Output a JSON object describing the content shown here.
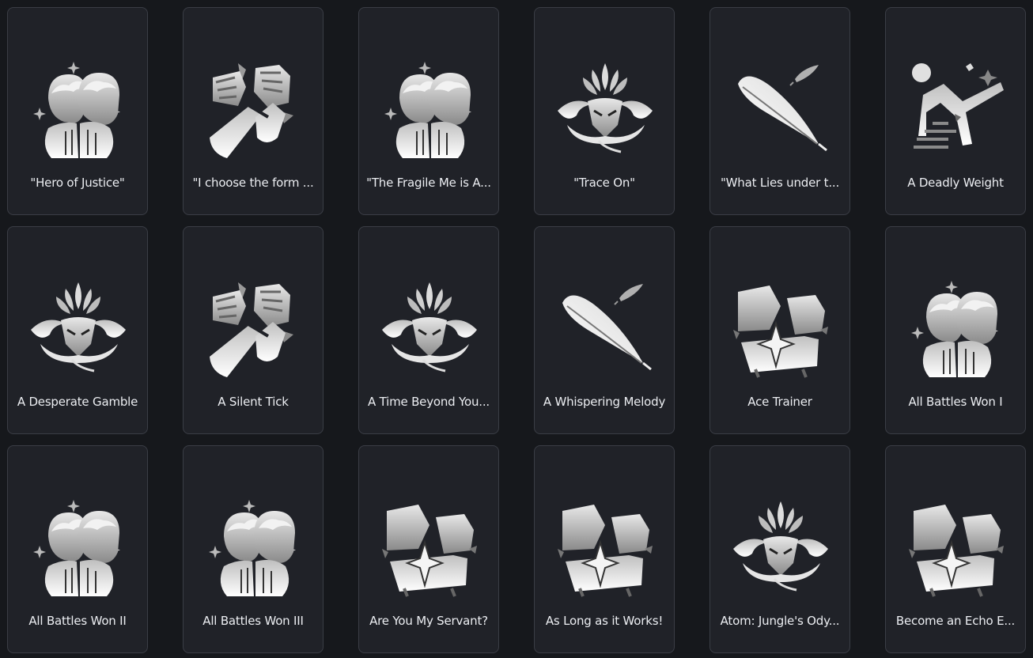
{
  "achievements": [
    {
      "name": "\"Hero of Justice\"",
      "icon": "twins-portrait-icon"
    },
    {
      "name": "\"I choose the form ...",
      "icon": "clashing-fists-icon"
    },
    {
      "name": "\"The Fragile Me is A...",
      "icon": "twins-portrait-icon"
    },
    {
      "name": "\"Trace On\"",
      "icon": "dragon-emblem-icon"
    },
    {
      "name": "\"What Lies under t...",
      "icon": "feather-icon"
    },
    {
      "name": "A Deadly Weight",
      "icon": "falling-figure-icon"
    },
    {
      "name": "A Desperate Gamble",
      "icon": "dragon-emblem-icon"
    },
    {
      "name": "A Silent Tick",
      "icon": "clashing-fists-icon"
    },
    {
      "name": "A Time Beyond You...",
      "icon": "dragon-emblem-icon"
    },
    {
      "name": "A Whispering Melody",
      "icon": "feather-icon"
    },
    {
      "name": "Ace Trainer",
      "icon": "shattered-cube-icon"
    },
    {
      "name": "All Battles Won I",
      "icon": "twins-portrait-icon"
    },
    {
      "name": "All Battles Won II",
      "icon": "twins-portrait-icon"
    },
    {
      "name": "All Battles Won III",
      "icon": "twins-portrait-icon"
    },
    {
      "name": "Are You My Servant?",
      "icon": "shattered-cube-icon"
    },
    {
      "name": "As Long as it Works!",
      "icon": "shattered-cube-icon"
    },
    {
      "name": "Atom: Jungle's Ody...",
      "icon": "dragon-emblem-icon"
    },
    {
      "name": "Become an Echo E...",
      "icon": "shattered-cube-icon"
    }
  ]
}
